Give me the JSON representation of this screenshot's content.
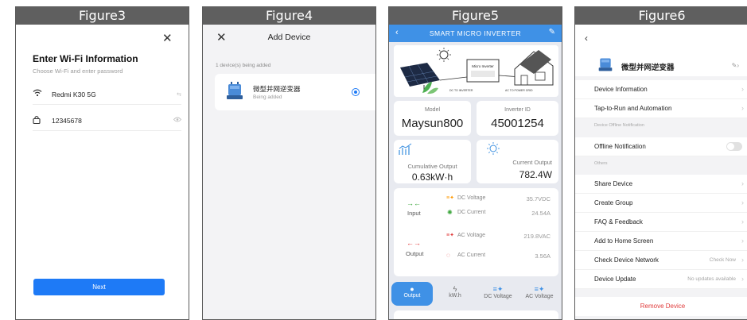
{
  "panels": {
    "fig3": "Figure3",
    "fig4": "Figure4",
    "fig5": "Figure5",
    "fig6": "Figure6"
  },
  "wifi_screen": {
    "title": "Enter Wi-Fi Information",
    "subtitle": "Choose Wi-Fi and enter password",
    "ssid": "Redmi K30 5G",
    "ssid_tail": "⇆",
    "password": "12345678",
    "next_label": "Next"
  },
  "add_screen": {
    "title": "Add Device",
    "added_count": "1 device(s) being added",
    "device_name": "微型并网逆变器",
    "device_status": "Being added"
  },
  "inverter_screen": {
    "title": "SMART MICRO INVERTER",
    "illus_label_box": "Micro Inverter",
    "illus_label_dc": "DC TO INVERTER",
    "illus_label_ac": "AC TO POWER GRID",
    "model_label": "Model",
    "model_value": "Maysun800",
    "inverter_id_label": "Inverter ID",
    "inverter_id_value": "45001254",
    "cumulative_label": "Cumulative Output",
    "cumulative_value": "0.63kW·h",
    "current_label": "Current Output",
    "current_value": "782.4W",
    "input_label": "Input",
    "output_label": "Output",
    "dc_voltage_label": "DC Voltage",
    "dc_voltage_value": "35.7VDC",
    "dc_current_label": "DC Current",
    "dc_current_value": "24.54A",
    "ac_voltage_label": "AC Voltage",
    "ac_voltage_value": "219.8VAC",
    "ac_current_label": "AC Current",
    "ac_current_value": "3.56A",
    "tabs": [
      "Output",
      "kW.h",
      "DC Voltage",
      "AC Voltage"
    ]
  },
  "settings_screen": {
    "device_name": "微型并网逆变器",
    "rows": {
      "device_info": "Device Information",
      "tap_to_run": "Tap-to-Run and Automation",
      "offline_section": "Device Offline Notification",
      "offline_notification": "Offline Notification",
      "others_section": "Others",
      "share": "Share Device",
      "create_group": "Create Group",
      "faq": "FAQ & Feedback",
      "add_home": "Add to Home Screen",
      "check_network": "Check Device Network",
      "check_network_value": "Check Now",
      "device_update": "Device Update",
      "device_update_value": "No updates available",
      "remove": "Remove Device"
    }
  },
  "colors": {
    "accent_blue": "#1e7af6",
    "inverter_blue": "#3f91e6",
    "remove_red": "#e03a3a",
    "header_gray": "#5f5f5f"
  }
}
